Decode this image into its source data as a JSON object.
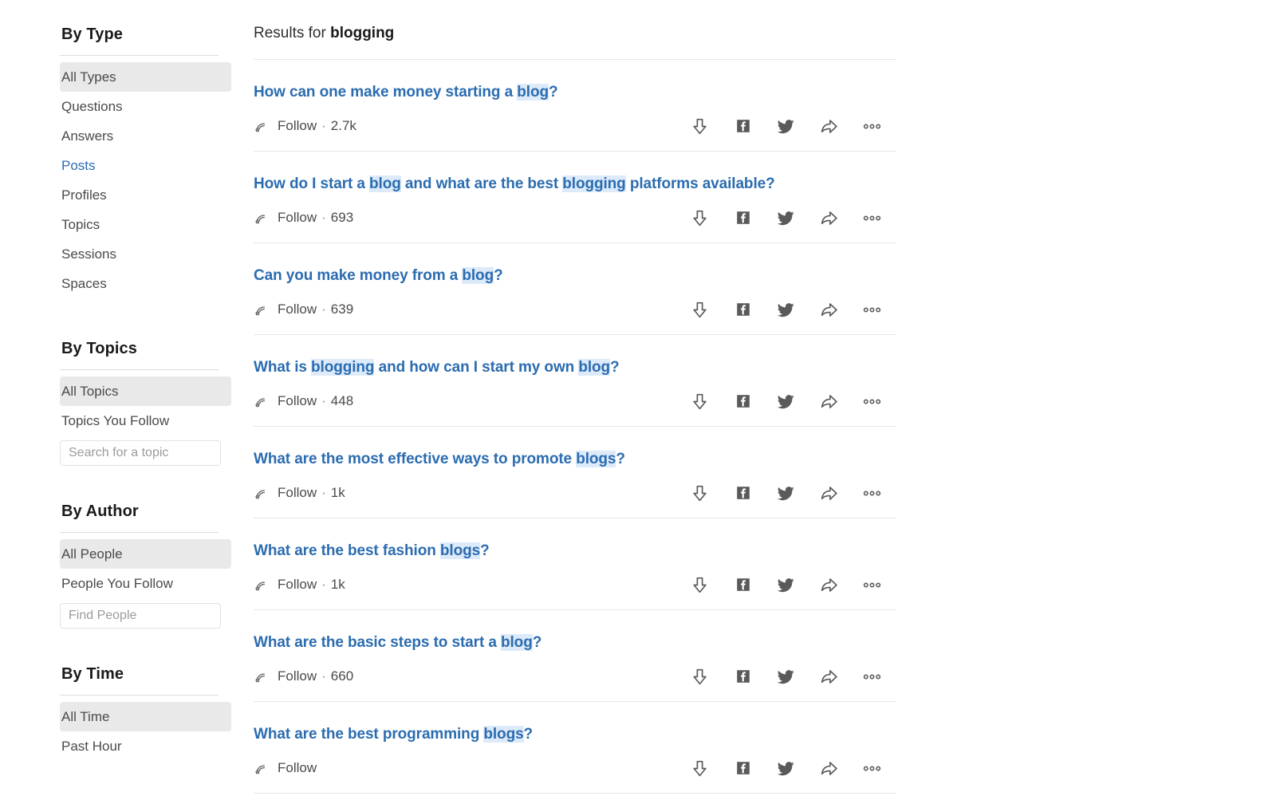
{
  "sidebar": {
    "sections": [
      {
        "title": "By Type",
        "items": [
          {
            "label": "All Types",
            "state": "selected"
          },
          {
            "label": "Questions",
            "state": "normal"
          },
          {
            "label": "Answers",
            "state": "normal"
          },
          {
            "label": "Posts",
            "state": "active-link"
          },
          {
            "label": "Profiles",
            "state": "normal"
          },
          {
            "label": "Topics",
            "state": "normal"
          },
          {
            "label": "Sessions",
            "state": "normal"
          },
          {
            "label": "Spaces",
            "state": "normal"
          }
        ]
      },
      {
        "title": "By Topics",
        "items": [
          {
            "label": "All Topics",
            "state": "selected"
          },
          {
            "label": "Topics You Follow",
            "state": "normal"
          }
        ],
        "input": {
          "name": "topic-search-input",
          "value": "",
          "placeholder": "Search for a topic"
        }
      },
      {
        "title": "By Author",
        "items": [
          {
            "label": "All People",
            "state": "selected"
          },
          {
            "label": "People You Follow",
            "state": "normal"
          }
        ],
        "input": {
          "name": "people-search-input",
          "value": "",
          "placeholder": "Find People"
        }
      },
      {
        "title": "By Time",
        "items": [
          {
            "label": "All Time",
            "state": "selected"
          },
          {
            "label": "Past Hour",
            "state": "normal"
          }
        ]
      }
    ]
  },
  "main": {
    "results_header_prefix": "Results for ",
    "query": "blogging",
    "follow_label": "Follow",
    "separator": "·",
    "action_icons": [
      "downvote-icon",
      "facebook-icon",
      "twitter-icon",
      "share-icon",
      "more-options-icon"
    ],
    "results": [
      {
        "parts": [
          {
            "text": "How can one make money starting a ",
            "hl": false
          },
          {
            "text": "blog",
            "hl": true
          },
          {
            "text": "?",
            "hl": false
          }
        ],
        "follow_count": "2.7k"
      },
      {
        "parts": [
          {
            "text": "How do I start a ",
            "hl": false
          },
          {
            "text": "blog",
            "hl": true
          },
          {
            "text": " and what are the best ",
            "hl": false
          },
          {
            "text": "blogging",
            "hl": true
          },
          {
            "text": " platforms available?",
            "hl": false
          }
        ],
        "follow_count": "693"
      },
      {
        "parts": [
          {
            "text": "Can you make money from a ",
            "hl": false
          },
          {
            "text": "blog",
            "hl": true
          },
          {
            "text": "?",
            "hl": false
          }
        ],
        "follow_count": "639"
      },
      {
        "parts": [
          {
            "text": "What is ",
            "hl": false
          },
          {
            "text": "blogging",
            "hl": true
          },
          {
            "text": " and how can I start my own ",
            "hl": false
          },
          {
            "text": "blog",
            "hl": true
          },
          {
            "text": "?",
            "hl": false
          }
        ],
        "follow_count": "448"
      },
      {
        "parts": [
          {
            "text": "What are the most effective ways to promote ",
            "hl": false
          },
          {
            "text": "blogs",
            "hl": true
          },
          {
            "text": "?",
            "hl": false
          }
        ],
        "follow_count": "1k"
      },
      {
        "parts": [
          {
            "text": "What are the best fashion ",
            "hl": false
          },
          {
            "text": "blogs",
            "hl": true
          },
          {
            "text": "?",
            "hl": false
          }
        ],
        "follow_count": "1k"
      },
      {
        "parts": [
          {
            "text": "What are the basic steps to start a ",
            "hl": false
          },
          {
            "text": "blog",
            "hl": true
          },
          {
            "text": "?",
            "hl": false
          }
        ],
        "follow_count": "660"
      },
      {
        "parts": [
          {
            "text": "What are the best programming ",
            "hl": false
          },
          {
            "text": "blogs",
            "hl": true
          },
          {
            "text": "?",
            "hl": false
          }
        ],
        "follow_count": ""
      }
    ]
  },
  "colors": {
    "link": "#2b6cb0",
    "highlight": "#dceafa",
    "selected_bg": "#e9e9e9",
    "rule": "#e6e6e6",
    "icon": "#5a5a5a"
  }
}
